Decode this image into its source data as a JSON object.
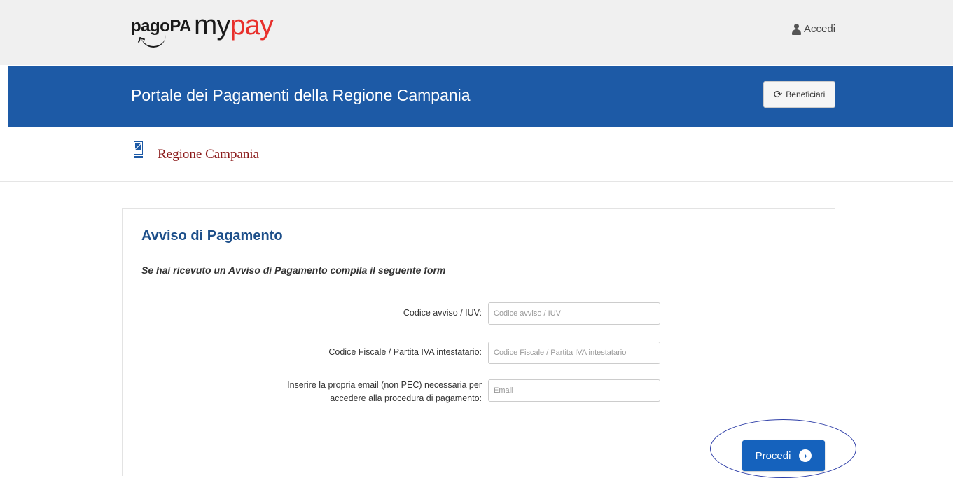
{
  "header": {
    "logo_pagopa": "pagoPA",
    "logo_mypay_my": "my",
    "logo_mypay_pay": "pay",
    "login_label": "Accedi"
  },
  "banner": {
    "title": "Portale dei Pagamenti della Regione Campania",
    "beneficiari_label": "Beneficiari"
  },
  "ente": {
    "name": "Regione Campania"
  },
  "panel": {
    "title": "Avviso di Pagamento",
    "subtitle": "Se hai ricevuto un Avviso di Pagamento compila il seguente form",
    "fields": [
      {
        "label": "Codice avviso / IUV:",
        "placeholder": "Codice avviso / IUV"
      },
      {
        "label": "Codice Fiscale / Partita IVA intestatario:",
        "placeholder": "Codice Fiscale / Partita IVA intestatario"
      },
      {
        "label": "Inserire la propria email (non PEC) necessaria per accedere alla procedura di pagamento:",
        "placeholder": "Email"
      }
    ],
    "submit_label": "Procedi"
  },
  "icons": {
    "user": "user-icon",
    "refresh": "refresh-icon",
    "crest": "regione-crest-icon",
    "arrow": "chevron-right-circle-icon"
  },
  "colors": {
    "banner_blue": "#1d5aa6",
    "title_blue": "#1d4f8a",
    "button_blue": "#1562bd",
    "brand_red": "#e8302c",
    "regione_red": "#8b1a1a"
  }
}
